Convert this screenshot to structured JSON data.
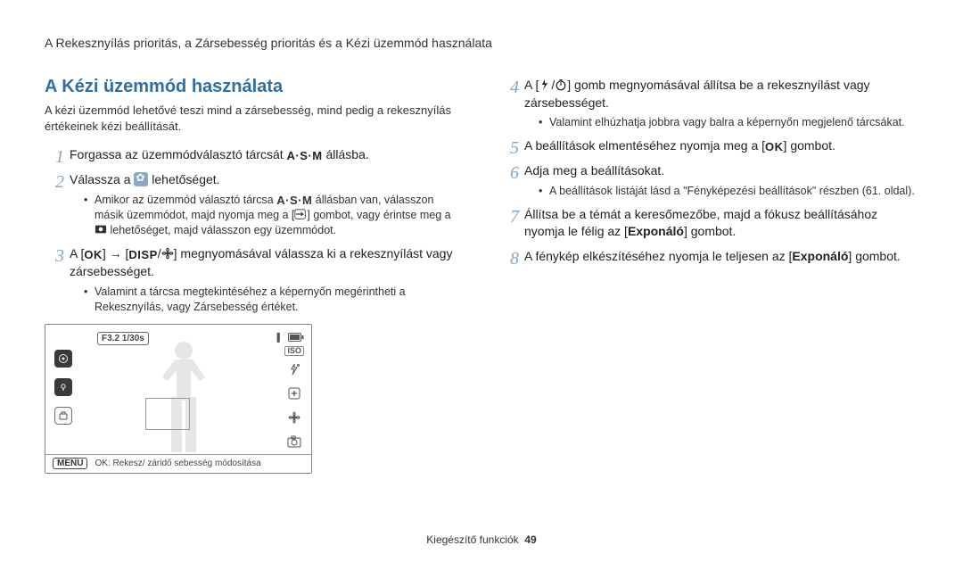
{
  "header": "A Rekesznyílás prioritás, a Zársebesség prioritás és a Kézi üzemmód használata",
  "section_title": "A Kézi üzemmód használata",
  "intro": "A kézi üzemmód lehetővé teszi mind a zársebesség, mind pedig a rekesznyílás értékeinek kézi beállítását.",
  "glyphs": {
    "asm": "A·S·M",
    "ok": "OK",
    "disp": "DISP"
  },
  "left_steps": {
    "s1_a": "Forgassa az üzemmódválasztó tárcsát ",
    "s1_b": " állásba.",
    "s2_a": "Válassza a ",
    "s2_b": " lehetőséget.",
    "s2_sub_a": "Amikor az üzemmód választó tárcsa ",
    "s2_sub_b": " állásban van, válasszon másik üzemmódot, majd nyomja meg a [",
    "s2_sub_c": "] gombot, vagy érintse meg a ",
    "s2_sub_d": " lehetőséget, majd válasszon egy üzemmódot.",
    "s3_a": "A [",
    "s3_b": "] → [",
    "s3_c": "/",
    "s3_d": "] megnyomásával válassza ki a rekesznyílást vagy zársebességet.",
    "s3_sub": "Valamint a tárcsa megtekintéséhez a képernyőn megérintheti a Rekesznyílás, vagy Zársebesség értéket."
  },
  "right_steps": {
    "s4_a": "A [",
    "s4_b": "/",
    "s4_c": "] gomb megnyomásával állítsa be a rekesznyílást vagy zársebességet.",
    "s4_sub": "Valamint elhúzhatja jobbra vagy balra a képernyőn megjelenő tárcsákat.",
    "s5_a": "A beállítások elmentéséhez nyomja meg a [",
    "s5_b": "] gombot.",
    "s6": "Adja meg a beállításokat.",
    "s6_sub": "A beállítások listáját lásd a \"Fényképezési beállítások\" részben (61. oldal).",
    "s7_a": "Állítsa be a témát a keresőmezőbe, majd a fókusz beállításához nyomja le félig az [",
    "s7_b": "Exponáló",
    "s7_c": "] gombot.",
    "s8_a": "A fénykép elkészítéséhez nyomja le teljesen az [",
    "s8_b": "Exponáló",
    "s8_c": "] gombot."
  },
  "lcd": {
    "badge": "F3.2 1/30s",
    "menu": "MENU",
    "bottom": "OK: Rekesz/ záridő sebesség módosítása",
    "iso": "ISO"
  },
  "footer": {
    "label": "Kiegészítő funkciók",
    "page": "49"
  }
}
